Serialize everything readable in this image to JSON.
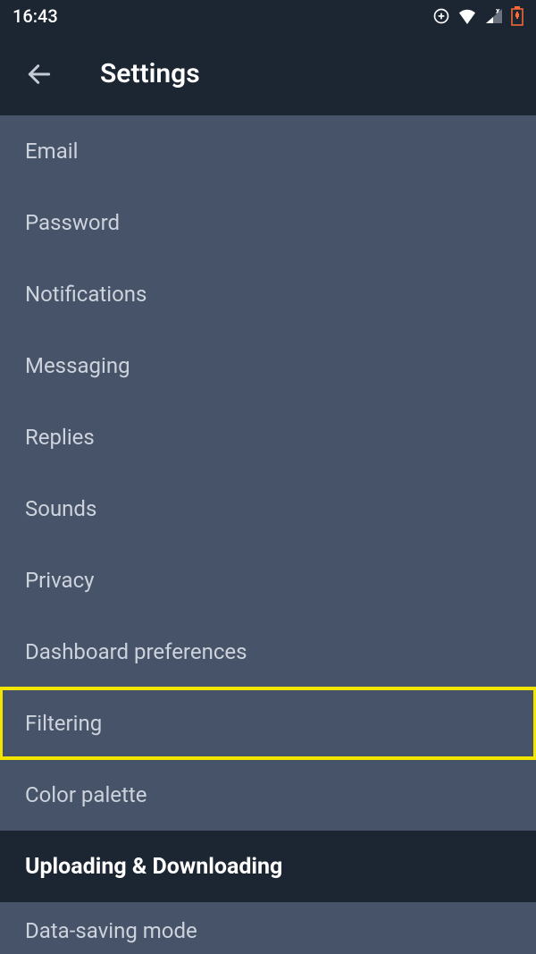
{
  "status": {
    "time": "16:43"
  },
  "header": {
    "title": "Settings"
  },
  "items": [
    {
      "label": "Email",
      "highlight": false
    },
    {
      "label": "Password",
      "highlight": false
    },
    {
      "label": "Notifications",
      "highlight": false
    },
    {
      "label": "Messaging",
      "highlight": false
    },
    {
      "label": "Replies",
      "highlight": false
    },
    {
      "label": "Sounds",
      "highlight": false
    },
    {
      "label": "Privacy",
      "highlight": false
    },
    {
      "label": "Dashboard preferences",
      "highlight": false
    },
    {
      "label": "Filtering",
      "highlight": true
    },
    {
      "label": "Color palette",
      "highlight": false
    }
  ],
  "section": {
    "title": "Uploading & Downloading"
  },
  "partial": {
    "label": "Data-saving mode"
  }
}
